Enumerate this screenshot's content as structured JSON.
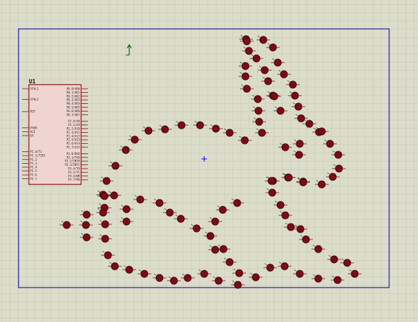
{
  "schematic": {
    "component_ref": "U1",
    "left_pins": [
      "XTAL1",
      "XTAL2",
      "RST",
      "PSEN",
      "ALE",
      "EA",
      "P1.0/T2",
      "P1.1/T2EX",
      "P1.2",
      "P1.3",
      "P1.4",
      "P1.5",
      "P1.6",
      "P1.7"
    ],
    "right_pins": [
      "P0.0/AD0",
      "P0.1/AD1",
      "P0.2/AD2",
      "P0.3/AD3",
      "P0.4/AD4",
      "P0.5/AD5",
      "P0.6/AD6",
      "P0.7/AD7",
      "P2.0/A8",
      "P2.1/A9",
      "P2.2/A10",
      "P2.3/A11",
      "P2.4/A12",
      "P2.5/A13",
      "P2.6/A14",
      "P2.7/A15",
      "P3.0/RXD",
      "P3.1/TXD",
      "P3.2/INT0",
      "P3.3/INT1",
      "P3.4/T0",
      "P3.5/T1",
      "P3.6/WR",
      "P3.7/RD"
    ],
    "led_count": 118
  },
  "colors": {
    "grid_bg": "#dcdccb",
    "grid_line": "#c6c6b4",
    "border": "#1a1aa8",
    "led_fill": "#7a0c14",
    "chip_body": "#f0d4d0",
    "chip_border": "#8a0a14",
    "origin_marker": "#006a00",
    "cursor_cross": "#0000cc"
  },
  "icons": {
    "origin": "origin-arrow-icon",
    "cursor": "crosshair-icon"
  }
}
